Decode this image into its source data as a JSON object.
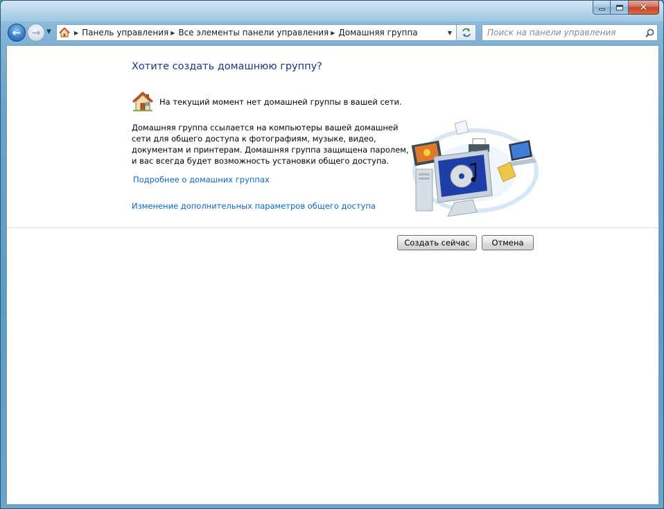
{
  "window": {
    "caption_buttons": [
      "minimize",
      "maximize",
      "close"
    ]
  },
  "navigation": {
    "back_icon": "back-arrow-icon",
    "forward_icon": "forward-arrow-icon",
    "breadcrumbs": [
      {
        "label": "Панель управления"
      },
      {
        "label": "Все элементы панели управления"
      },
      {
        "label": "Домашняя группа"
      }
    ],
    "search_placeholder": "Поиск на панели управления"
  },
  "main": {
    "title": "Хотите создать домашнюю группу?",
    "status_text": "На текущий момент нет домашней группы в вашей сети.",
    "description": "Домашняя группа ссылается на компьютеры вашей домашней сети для общего доступа к фотографиям, музыке, видео, документам и принтерам. Домашняя группа защищена паролем, и вас всегда будет возможность установки общего доступа.",
    "link_learn_more": "Подробнее о домашних группах",
    "link_advanced_sharing": "Изменение дополнительных параметров общего доступа"
  },
  "buttons": {
    "create_label": "Создать сейчас",
    "cancel_label": "Отмена"
  },
  "colors": {
    "title": "#1e3287",
    "link": "#0b66c4",
    "frame": "#6aa4cd"
  }
}
